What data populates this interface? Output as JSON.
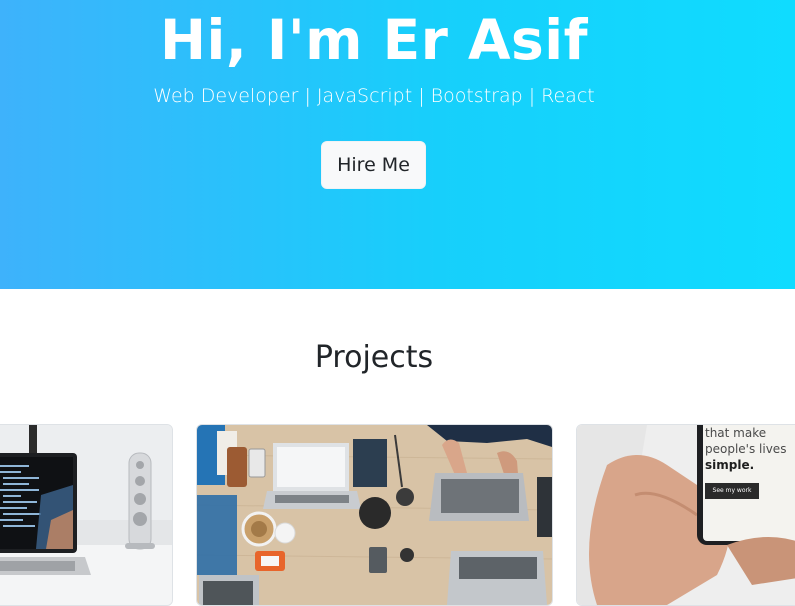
{
  "hero": {
    "title": "Hi, I'm Er Asif",
    "subtitle": "Web Developer | JavaScript | Bootstrap | React",
    "cta_label": "Hire Me"
  },
  "projects": {
    "heading": "Projects",
    "cards": [
      {
        "image": "laptop-code-desk-photo"
      },
      {
        "image": "team-laptops-desk-photo"
      },
      {
        "image": "hand-holding-phone-photo",
        "phone_text": {
          "line1": "that make",
          "line2": "people's lives",
          "line3": "simple.",
          "button": "See my work"
        }
      }
    ]
  },
  "colors": {
    "hero_gradient_start": "#3eb2fb",
    "hero_gradient_end": "#0fdcff",
    "button_bg": "#f8f9fa",
    "text_dark": "#212529"
  }
}
